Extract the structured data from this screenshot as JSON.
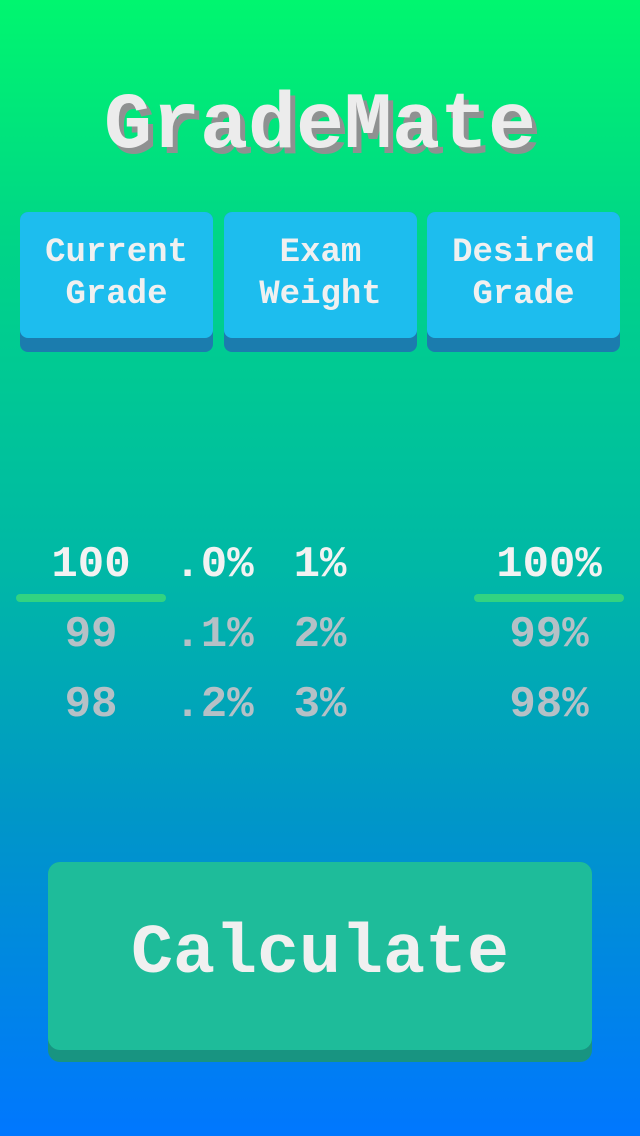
{
  "app": {
    "title": "GradeMate"
  },
  "tabs": [
    {
      "label": "Current\nGrade"
    },
    {
      "label": "Exam\nWeight"
    },
    {
      "label": "Desired\nGrade"
    }
  ],
  "pickers": {
    "current_grade": {
      "options": [
        "100",
        "99",
        "98"
      ],
      "selected": "100"
    },
    "decimal": {
      "options": [
        ".0%",
        ".1%",
        ".2%"
      ],
      "selected": ".0%"
    },
    "exam_weight": {
      "options": [
        "1%",
        "2%",
        "3%"
      ],
      "selected": "1%"
    },
    "desired_grade": {
      "options": [
        "100%",
        "99%",
        "98%"
      ],
      "selected": "100%"
    }
  },
  "calculate": {
    "label": "Calculate"
  },
  "colors": {
    "tab_face": "#1dbdee",
    "tab_shadow": "#1b7cae",
    "button_face": "#1ebc9a",
    "button_shadow": "#189481",
    "underline": "#32d381",
    "text_light": "#f2f2f2",
    "text_dim": "#b5c0c6"
  }
}
